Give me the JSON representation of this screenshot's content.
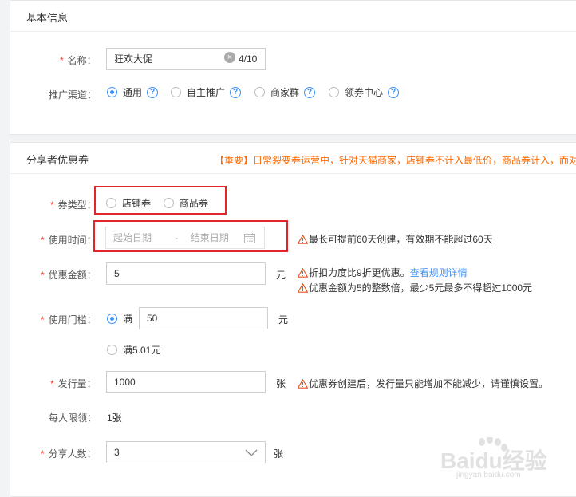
{
  "basic_section": {
    "title": "基本信息",
    "name_field": {
      "label": "名称：",
      "value": "狂欢大促",
      "counter": "4/10"
    },
    "channel": {
      "label": "推广渠道：",
      "options": [
        {
          "label": "通用",
          "selected": true
        },
        {
          "label": "自主推广",
          "selected": false
        },
        {
          "label": "商家群",
          "selected": false
        },
        {
          "label": "领券中心",
          "selected": false
        }
      ]
    }
  },
  "coupon_section": {
    "title": "分享者优惠券",
    "notice": "【重要】日常裂变券运营中，针对天猫商家，店铺券不计入最低价，商品券计入，而对",
    "coupon_type": {
      "label": "券类型：",
      "options": [
        {
          "label": "店铺券",
          "selected": false
        },
        {
          "label": "商品券",
          "selected": false
        }
      ]
    },
    "use_time": {
      "label": "使用时间：",
      "start_placeholder": "起始日期",
      "separator": "-",
      "end_placeholder": "结束日期",
      "hint": "最长可提前60天创建，有效期不能超过60天"
    },
    "amount": {
      "label": "优惠金额：",
      "value": "5",
      "unit": "元",
      "hint1": "折扣力度比9折更优惠。",
      "hint1_link": "查看规则详情",
      "hint2": "优惠金额为5的整数倍，最少5元最多不得超过1000元"
    },
    "threshold": {
      "label": "使用门槛：",
      "option1_label": "满",
      "option1_value": "50",
      "option1_unit": "元",
      "option1_selected": true,
      "option2_label": "满5.01元",
      "option2_selected": false
    },
    "quantity": {
      "label": "发行量：",
      "value": "1000",
      "unit": "张",
      "hint": "优惠券创建后，发行量只能增加不能减少，请谨慎设置。"
    },
    "limit": {
      "label": "每人限领：",
      "value": "1张"
    },
    "share_count": {
      "label": "分享人数：",
      "value": "3",
      "unit": "张"
    }
  },
  "colors": {
    "accent": "#3b8ff6",
    "required": "#ff3b30",
    "notice": "#ff6a00",
    "highlight_box": "#e0262b",
    "warning": "#e8541e"
  },
  "watermark": {
    "text": "Baidu经验",
    "url_text": "jingyan.baidu.com"
  }
}
